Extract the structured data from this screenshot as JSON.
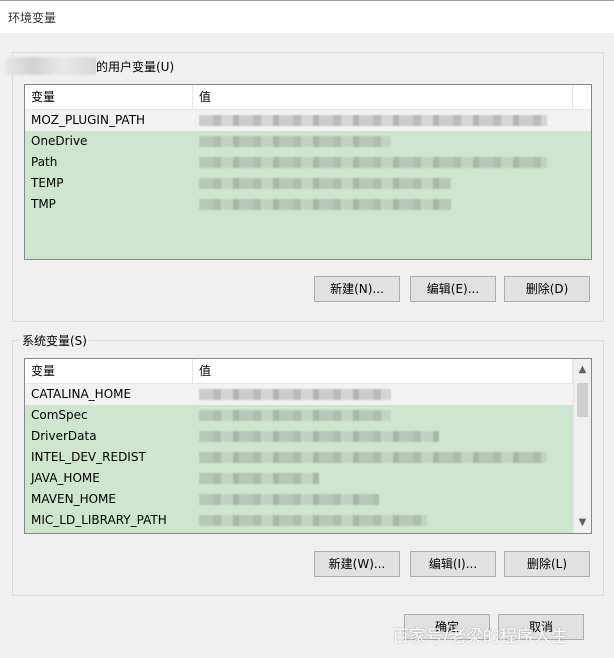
{
  "window": {
    "title": "环境变量"
  },
  "user_section": {
    "label_suffix": "的用户变量(U)",
    "columns": [
      "变量",
      "值"
    ],
    "rows": [
      {
        "name": "MOZ_PLUGIN_PATH",
        "selected": true
      },
      {
        "name": "OneDrive",
        "selected": false
      },
      {
        "name": "Path",
        "selected": false
      },
      {
        "name": "TEMP",
        "selected": false
      },
      {
        "name": "TMP",
        "selected": false
      }
    ],
    "buttons": {
      "new": "新建(N)...",
      "edit": "编辑(E)...",
      "delete": "删除(D)"
    }
  },
  "system_section": {
    "label": "系统变量(S)",
    "columns": [
      "变量",
      "值"
    ],
    "rows": [
      {
        "name": "CATALINA_HOME",
        "selected": true
      },
      {
        "name": "ComSpec",
        "selected": false
      },
      {
        "name": "DriverData",
        "selected": false
      },
      {
        "name": "INTEL_DEV_REDIST",
        "selected": false
      },
      {
        "name": "JAVA_HOME",
        "selected": false
      },
      {
        "name": "MAVEN_HOME",
        "selected": false
      },
      {
        "name": "MIC_LD_LIBRARY_PATH",
        "selected": false
      }
    ],
    "buttons": {
      "new": "新建(W)...",
      "edit": "编辑(I)...",
      "delete": "删除(L)"
    }
  },
  "footer": {
    "ok": "确定",
    "cancel": "取消"
  },
  "watermark": "百家号/老梁的程序人生",
  "colors": {
    "list_background": "#cde6cd",
    "selected_row": "#f2f2f2",
    "button_face": "#e1e1e1"
  }
}
